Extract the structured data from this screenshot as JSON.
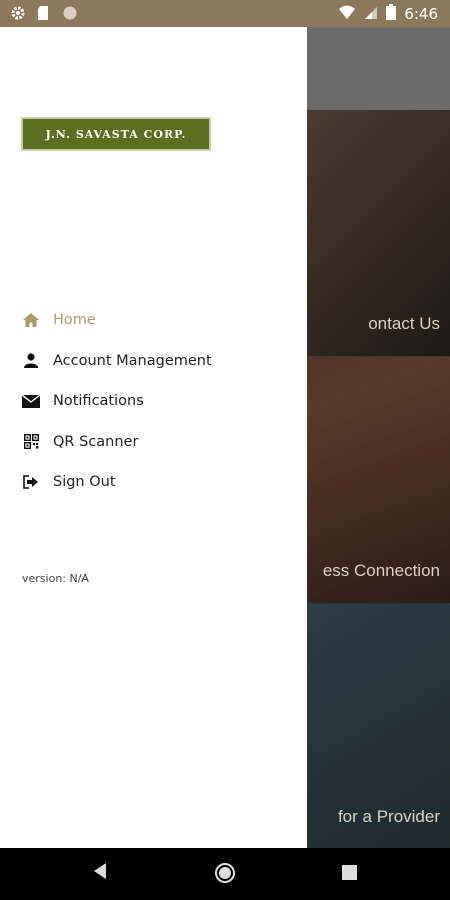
{
  "status_bar": {
    "time": "6:46",
    "icons": [
      "settings-icon",
      "sd-card-icon",
      "circle-icon",
      "wifi-icon",
      "signal-icon",
      "battery-icon"
    ]
  },
  "background_tiles": [
    {
      "label": "ontact Us"
    },
    {
      "label": "ess Connection"
    },
    {
      "label": "for a Provider"
    }
  ],
  "drawer": {
    "logo_text": "J.N. SAVASTA CORP.",
    "menu": [
      {
        "label": "Home",
        "icon": "home-icon",
        "active": true
      },
      {
        "label": "Account Management",
        "icon": "person-icon",
        "active": false
      },
      {
        "label": "Notifications",
        "icon": "envelope-icon",
        "active": false
      },
      {
        "label": "QR Scanner",
        "icon": "qr-code-icon",
        "active": false
      },
      {
        "label": "Sign Out",
        "icon": "sign-out-icon",
        "active": false
      }
    ],
    "version": "version: N/A"
  },
  "colors": {
    "status_bar": "#8a7a5a",
    "logo_bg": "#5b6f1f",
    "active_item": "#b09a6a"
  }
}
